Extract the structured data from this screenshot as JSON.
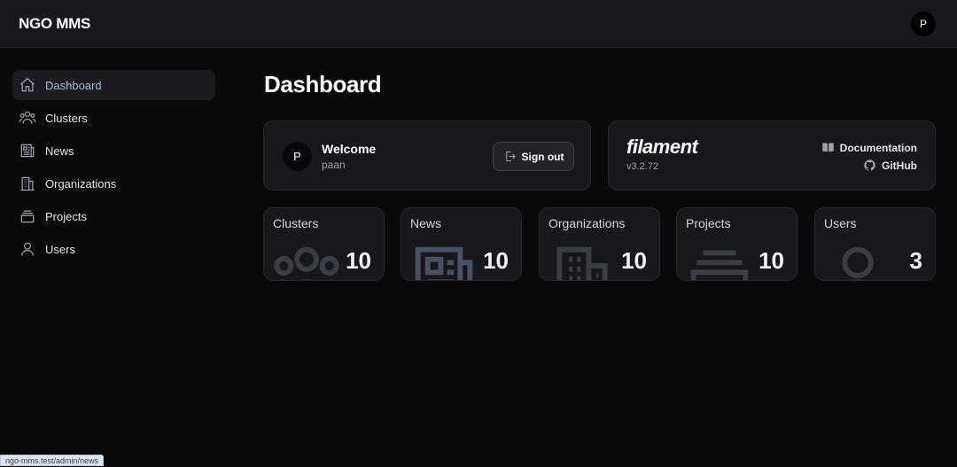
{
  "app": {
    "title": "NGO MMS",
    "user_initial": "P"
  },
  "sidebar": {
    "items": [
      {
        "label": "Dashboard",
        "icon": "home-icon",
        "active": true
      },
      {
        "label": "Clusters",
        "icon": "user-group-icon"
      },
      {
        "label": "News",
        "icon": "newspaper-icon"
      },
      {
        "label": "Organizations",
        "icon": "building-icon"
      },
      {
        "label": "Projects",
        "icon": "stack-icon"
      },
      {
        "label": "Users",
        "icon": "user-icon"
      }
    ]
  },
  "page": {
    "title": "Dashboard"
  },
  "welcome": {
    "avatar_initial": "P",
    "title": "Welcome",
    "username": "paan",
    "signout_label": "Sign out"
  },
  "filament": {
    "logo": "filament",
    "version": "v3.2.72",
    "doc_label": "Documentation",
    "github_label": "GitHub"
  },
  "stats": [
    {
      "label": "Clusters",
      "value": "10",
      "icon": "user-group-icon"
    },
    {
      "label": "News",
      "value": "10",
      "icon": "newspaper-icon"
    },
    {
      "label": "Organizations",
      "value": "10",
      "icon": "building-icon"
    },
    {
      "label": "Projects",
      "value": "10",
      "icon": "stack-icon"
    },
    {
      "label": "Users",
      "value": "3",
      "icon": "user-icon"
    }
  ],
  "status_bar": {
    "url": "ngo-mms.test/admin/news"
  }
}
